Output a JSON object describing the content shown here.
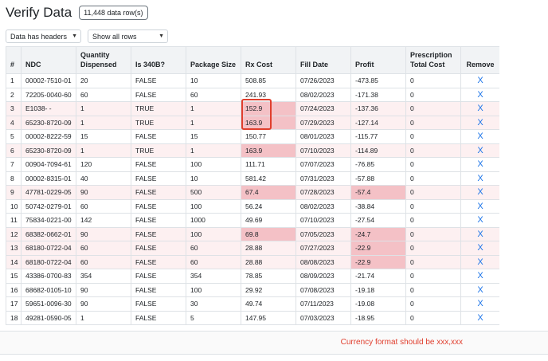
{
  "header": {
    "title": "Verify Data",
    "row_count": "11,448 data row(s)"
  },
  "controls": {
    "headers_select": "Data has headers",
    "rows_select": "Show all rows"
  },
  "table": {
    "columns": [
      "#",
      "NDC",
      "Quantity Dispensed",
      "Is 340B?",
      "Package Size",
      "Rx Cost",
      "Fill Date",
      "Profit",
      "Prescription Total Cost",
      "Remove"
    ],
    "remove_symbol": "X",
    "rows": [
      {
        "n": "1",
        "ndc": "00002-7510-01",
        "qty": "20",
        "is340b": "FALSE",
        "pkg": "10",
        "rx": "508.85",
        "fill": "07/26/2023",
        "profit": "-473.85",
        "total": "0",
        "hl_row": false,
        "hl_rx": false,
        "hl_profit": false
      },
      {
        "n": "2",
        "ndc": "72205-0040-60",
        "qty": "60",
        "is340b": "FALSE",
        "pkg": "60",
        "rx": "241.93",
        "fill": "08/02/2023",
        "profit": "-171.38",
        "total": "0",
        "hl_row": false,
        "hl_rx": false,
        "hl_profit": false
      },
      {
        "n": "3",
        "ndc": "E1038-   -",
        "qty": "1",
        "is340b": "TRUE",
        "pkg": "1",
        "rx": "152.9",
        "fill": "07/24/2023",
        "profit": "-137.36",
        "total": "0",
        "hl_row": true,
        "hl_rx": true,
        "hl_profit": false
      },
      {
        "n": "4",
        "ndc": "65230-8720-09",
        "qty": "1",
        "is340b": "TRUE",
        "pkg": "1",
        "rx": "163.9",
        "fill": "07/29/2023",
        "profit": "-127.14",
        "total": "0",
        "hl_row": true,
        "hl_rx": true,
        "hl_profit": false
      },
      {
        "n": "5",
        "ndc": "00002-8222-59",
        "qty": "15",
        "is340b": "FALSE",
        "pkg": "15",
        "rx": "150.77",
        "fill": "08/01/2023",
        "profit": "-115.77",
        "total": "0",
        "hl_row": false,
        "hl_rx": false,
        "hl_profit": false
      },
      {
        "n": "6",
        "ndc": "65230-8720-09",
        "qty": "1",
        "is340b": "TRUE",
        "pkg": "1",
        "rx": "163.9",
        "fill": "07/10/2023",
        "profit": "-114.89",
        "total": "0",
        "hl_row": true,
        "hl_rx": true,
        "hl_profit": false
      },
      {
        "n": "7",
        "ndc": "00904-7094-61",
        "qty": "120",
        "is340b": "FALSE",
        "pkg": "100",
        "rx": "111.71",
        "fill": "07/07/2023",
        "profit": "-76.85",
        "total": "0",
        "hl_row": false,
        "hl_rx": false,
        "hl_profit": false
      },
      {
        "n": "8",
        "ndc": "00002-8315-01",
        "qty": "40",
        "is340b": "FALSE",
        "pkg": "10",
        "rx": "581.42",
        "fill": "07/31/2023",
        "profit": "-57.88",
        "total": "0",
        "hl_row": false,
        "hl_rx": false,
        "hl_profit": false
      },
      {
        "n": "9",
        "ndc": "47781-0229-05",
        "qty": "90",
        "is340b": "FALSE",
        "pkg": "500",
        "rx": "67.4",
        "fill": "07/28/2023",
        "profit": "-57.4",
        "total": "0",
        "hl_row": true,
        "hl_rx": true,
        "hl_profit": true
      },
      {
        "n": "10",
        "ndc": "50742-0279-01",
        "qty": "60",
        "is340b": "FALSE",
        "pkg": "100",
        "rx": "56.24",
        "fill": "08/02/2023",
        "profit": "-38.84",
        "total": "0",
        "hl_row": false,
        "hl_rx": false,
        "hl_profit": false
      },
      {
        "n": "11",
        "ndc": "75834-0221-00",
        "qty": "142",
        "is340b": "FALSE",
        "pkg": "1000",
        "rx": "49.69",
        "fill": "07/10/2023",
        "profit": "-27.54",
        "total": "0",
        "hl_row": false,
        "hl_rx": false,
        "hl_profit": false
      },
      {
        "n": "12",
        "ndc": "68382-0662-01",
        "qty": "90",
        "is340b": "FALSE",
        "pkg": "100",
        "rx": "69.8",
        "fill": "07/05/2023",
        "profit": "-24.7",
        "total": "0",
        "hl_row": true,
        "hl_rx": true,
        "hl_profit": true
      },
      {
        "n": "13",
        "ndc": "68180-0722-04",
        "qty": "60",
        "is340b": "FALSE",
        "pkg": "60",
        "rx": "28.88",
        "fill": "07/27/2023",
        "profit": "-22.9",
        "total": "0",
        "hl_row": true,
        "hl_rx": false,
        "hl_profit": true
      },
      {
        "n": "14",
        "ndc": "68180-0722-04",
        "qty": "60",
        "is340b": "FALSE",
        "pkg": "60",
        "rx": "28.88",
        "fill": "08/08/2023",
        "profit": "-22.9",
        "total": "0",
        "hl_row": true,
        "hl_rx": false,
        "hl_profit": true
      },
      {
        "n": "15",
        "ndc": "43386-0700-83",
        "qty": "354",
        "is340b": "FALSE",
        "pkg": "354",
        "rx": "78.85",
        "fill": "08/09/2023",
        "profit": "-21.74",
        "total": "0",
        "hl_row": false,
        "hl_rx": false,
        "hl_profit": false
      },
      {
        "n": "16",
        "ndc": "68682-0105-10",
        "qty": "90",
        "is340b": "FALSE",
        "pkg": "100",
        "rx": "29.92",
        "fill": "07/08/2023",
        "profit": "-19.18",
        "total": "0",
        "hl_row": false,
        "hl_rx": false,
        "hl_profit": false
      },
      {
        "n": "17",
        "ndc": "59651-0096-30",
        "qty": "90",
        "is340b": "FALSE",
        "pkg": "30",
        "rx": "49.74",
        "fill": "07/11/2023",
        "profit": "-19.08",
        "total": "0",
        "hl_row": false,
        "hl_rx": false,
        "hl_profit": false
      },
      {
        "n": "18",
        "ndc": "49281-0590-05",
        "qty": "1",
        "is340b": "FALSE",
        "pkg": "5",
        "rx": "147.95",
        "fill": "07/03/2023",
        "profit": "-18.95",
        "total": "0",
        "hl_row": false,
        "hl_rx": false,
        "hl_profit": false
      }
    ]
  },
  "footer": {
    "error_message": "Currency format should be xxx,xxx"
  }
}
